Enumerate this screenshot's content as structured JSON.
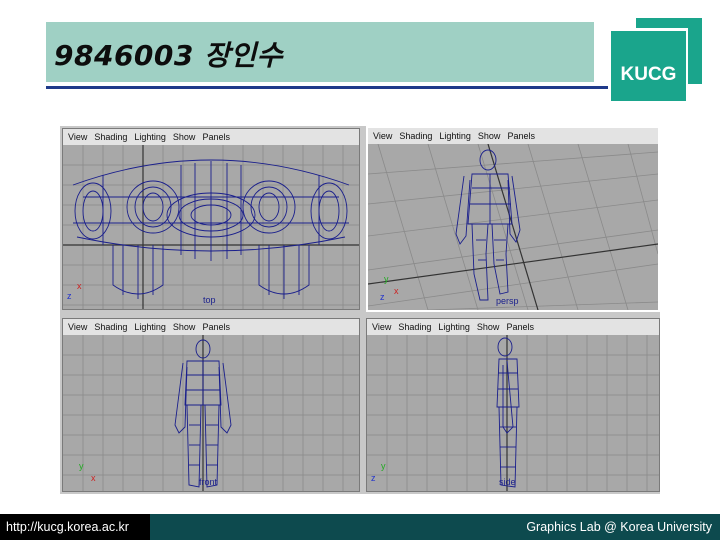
{
  "slide": {
    "title": "9846003 장인수",
    "logo_text": "KUCG",
    "footer_left": "http://kucg.korea.ac.kr",
    "footer_right": "Graphics Lab @ Korea University"
  },
  "menu": [
    "View",
    "Shading",
    "Lighting",
    "Show",
    "Panels"
  ],
  "viewports": [
    {
      "label": "top",
      "axis_a": "x",
      "axis_b": "z",
      "axis_a_color": "#cc2222",
      "axis_b_color": "#2233cc"
    },
    {
      "label": "persp",
      "axis_a": "y",
      "axis_b": "x",
      "axis_c": "z",
      "axis_a_color": "#22aa22",
      "axis_b_color": "#cc2222",
      "axis_c_color": "#2233cc"
    },
    {
      "label": "front",
      "axis_a": "y",
      "axis_b": "x",
      "axis_a_color": "#22aa22",
      "axis_b_color": "#cc2222"
    },
    {
      "label": "side",
      "axis_a": "y",
      "axis_b": "z",
      "axis_a_color": "#22aa22",
      "axis_b_color": "#2233cc"
    }
  ],
  "colors": {
    "wire": "#1a1f8c",
    "grid": "#8a8a8a",
    "grid_axis": "#333333",
    "background": "#a8a8a8",
    "title_band": "#9fd0c4",
    "accent": "#1aa58c"
  }
}
